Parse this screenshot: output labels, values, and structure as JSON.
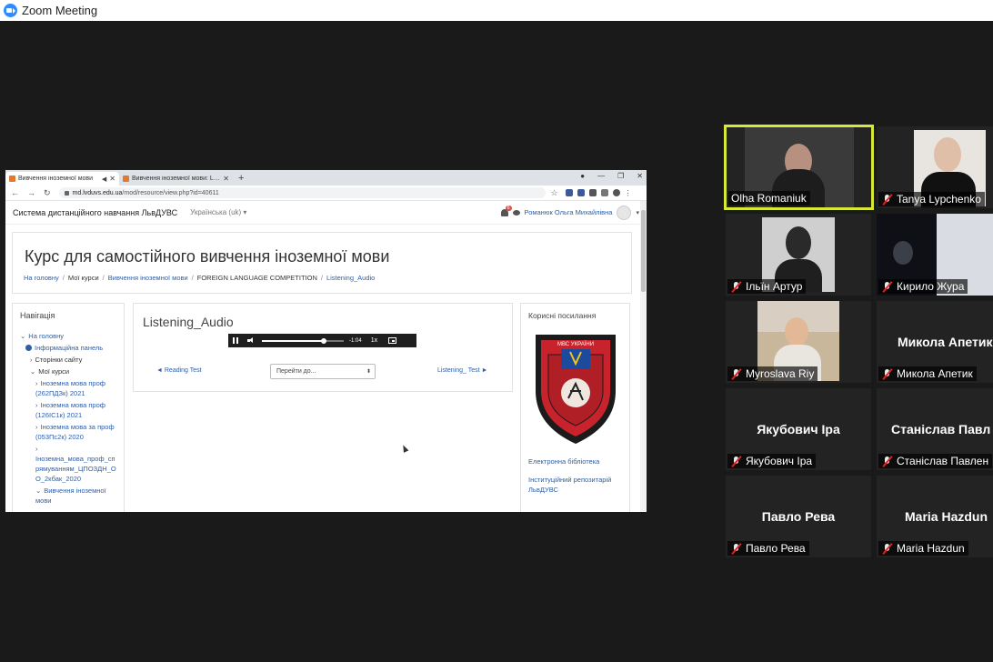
{
  "window": {
    "title": "Zoom Meeting"
  },
  "browser": {
    "tabs": [
      {
        "label": "Вивчення іноземної мови",
        "active": true
      },
      {
        "label": "Вивчення іноземної мови: Listening",
        "active": false
      }
    ],
    "url_host": "md.lvduvs.edu.ua",
    "url_path": "/mod/resource/view.php?id=40611"
  },
  "moodle": {
    "site_name": "Система дистанційного навчання ЛьвДУВС",
    "language": "Українська ‎(uk)‎",
    "notification_count": "6",
    "user_name": "Романюк Ольга Михайлівна",
    "course_title": "Курс для самостійного вивчення іноземної мови",
    "breadcrumbs": [
      "На головну",
      "Мої курси",
      "Вивчення іноземної мови",
      "FOREIGN LANGUAGE COMPETITION",
      "Listening_Audio"
    ],
    "navigation": {
      "heading": "Навігація",
      "home": "На головну",
      "dashboard": "Інформаційна панель",
      "site_pages": "Сторінки сайту",
      "my_courses": "Мої курси",
      "courses": [
        "Іноземна мова проф (262ПДЗк) 2021",
        "Іноземна мова проф (126ІС1к) 2021",
        "Іноземна мова за проф (053Пс2к) 2020",
        "Іноземна_мова_проф_спрямуванням_ЦПОЗДН_ОО_2кбак_2020",
        "Вивчення іноземної мови"
      ]
    },
    "resource_title": "Listening_Audio",
    "player": {
      "time": "-1:04",
      "speed": "1x",
      "progress": 0.75
    },
    "prev_link": "◄ Reading Test",
    "jump_select": "Перейти до...",
    "next_link": "Listening_ Test ►",
    "useful_links": {
      "heading": "Корисні посилання",
      "links": [
        "Електронна бібліотека",
        "Інституційний репозитарій ЛьвДУВС"
      ]
    }
  },
  "participants": [
    {
      "name": "Olha Romaniuk",
      "speaking": true,
      "video": true,
      "muted": false
    },
    {
      "name": "Tanya Lypchenko",
      "speaking": false,
      "video": true,
      "muted": true
    },
    {
      "name": "Ільїн Артур",
      "speaking": false,
      "video": true,
      "muted": true
    },
    {
      "name": "Кирило Жура",
      "speaking": false,
      "video": true,
      "muted": true
    },
    {
      "name": "Myroslava Riy",
      "speaking": false,
      "video": true,
      "muted": true
    },
    {
      "name": "Микола Апетик",
      "display_name": "Микола Апетик",
      "speaking": false,
      "video": false,
      "muted": true
    },
    {
      "name": "Якубович Іра",
      "display_name": "Якубович Іра",
      "speaking": false,
      "video": false,
      "muted": true
    },
    {
      "name": "Станіслав Павлен",
      "display_name": "Станіслав  Павл",
      "speaking": false,
      "video": false,
      "muted": true
    },
    {
      "name": "Павло Рева",
      "display_name": "Павло Рева",
      "speaking": false,
      "video": false,
      "muted": true
    },
    {
      "name": "Maria Hazdun",
      "display_name": "Maria Hazdun",
      "speaking": false,
      "video": false,
      "muted": true
    }
  ],
  "emblem_text": "МВС УКРАЇНИ",
  "colors": {
    "zoom_blue": "#2d8cff",
    "active_speaker": "#d6e83a",
    "mute_red": "#e02424",
    "moodle_link": "#2d5fa8"
  }
}
